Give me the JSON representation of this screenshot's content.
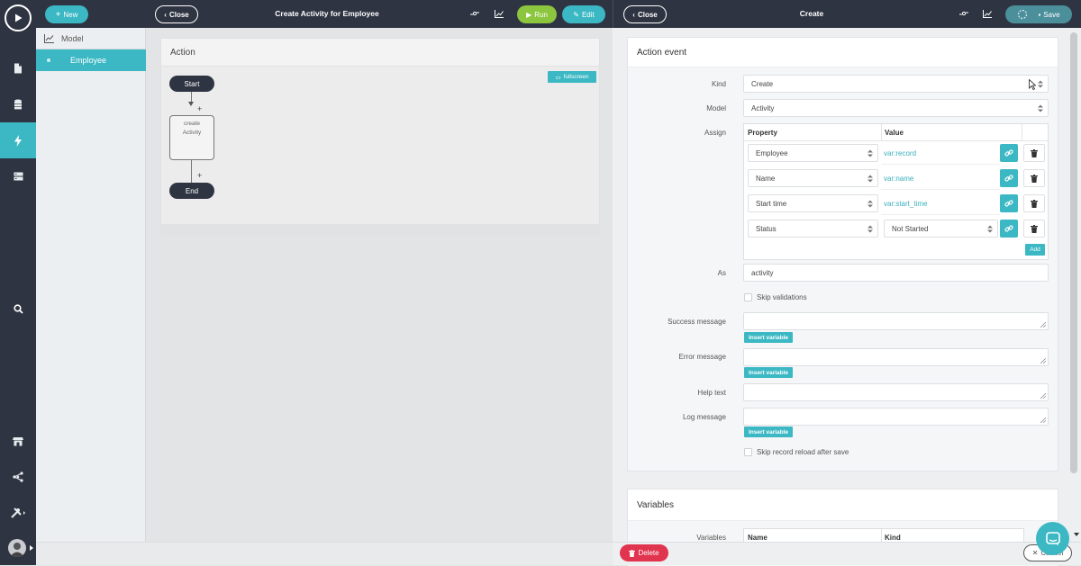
{
  "nav": {
    "new_label": "New",
    "icons": [
      "play-icon",
      "document-icon",
      "database-icon",
      "bolt-icon",
      "server-icon",
      "search-icon",
      "store-icon",
      "share-icon",
      "tools-icon",
      "user-avatar"
    ]
  },
  "sidebar": {
    "items": [
      {
        "label": "Model",
        "icon": "chart-icon"
      },
      {
        "label": "Employee",
        "active": true
      }
    ]
  },
  "left_header": {
    "close_label": "Close",
    "title": "Create Activity for Employee",
    "run_label": "Run",
    "edit_label": "Edit"
  },
  "action_panel": {
    "title": "Action",
    "fullscreen_label": "fullscreen",
    "flow": {
      "start": "Start",
      "step_line1": "create",
      "step_line2": "Activity",
      "end": "End",
      "plus": "+"
    }
  },
  "right_header": {
    "close_label": "Close",
    "title": "Create",
    "save_label": "Save"
  },
  "action_event": {
    "title": "Action event",
    "kind_label": "Kind",
    "kind_value": "Create",
    "model_label": "Model",
    "model_value": "Activity",
    "assign_label": "Assign",
    "assign_headers": {
      "property": "Property",
      "value": "Value"
    },
    "assign_rows": [
      {
        "property": "Employee",
        "value": "var:record",
        "value_type": "var"
      },
      {
        "property": "Name",
        "value": "var:name",
        "value_type": "var"
      },
      {
        "property": "Start time",
        "value": "var:start_time",
        "value_type": "var"
      },
      {
        "property": "Status",
        "value": "Not Started",
        "value_type": "select"
      }
    ],
    "add_label": "Add",
    "as_label": "As",
    "as_value": "activity",
    "skip_validations_label": "Skip validations",
    "success_label": "Success message",
    "error_label": "Error message",
    "help_label": "Help text",
    "log_label": "Log message",
    "insert_variable_label": "Insert variable",
    "skip_reload_label": "Skip record reload after save"
  },
  "variables": {
    "title": "Variables",
    "label": "Variables",
    "headers": {
      "name": "Name",
      "kind": "Kind"
    }
  },
  "footer": {
    "delete_label": "Delete",
    "cancel_label": "Cancel"
  },
  "colors": {
    "teal": "#3bb8c4",
    "green": "#8cc63f",
    "dark_nav": "#2f3442",
    "delete_red": "#e0344f"
  }
}
